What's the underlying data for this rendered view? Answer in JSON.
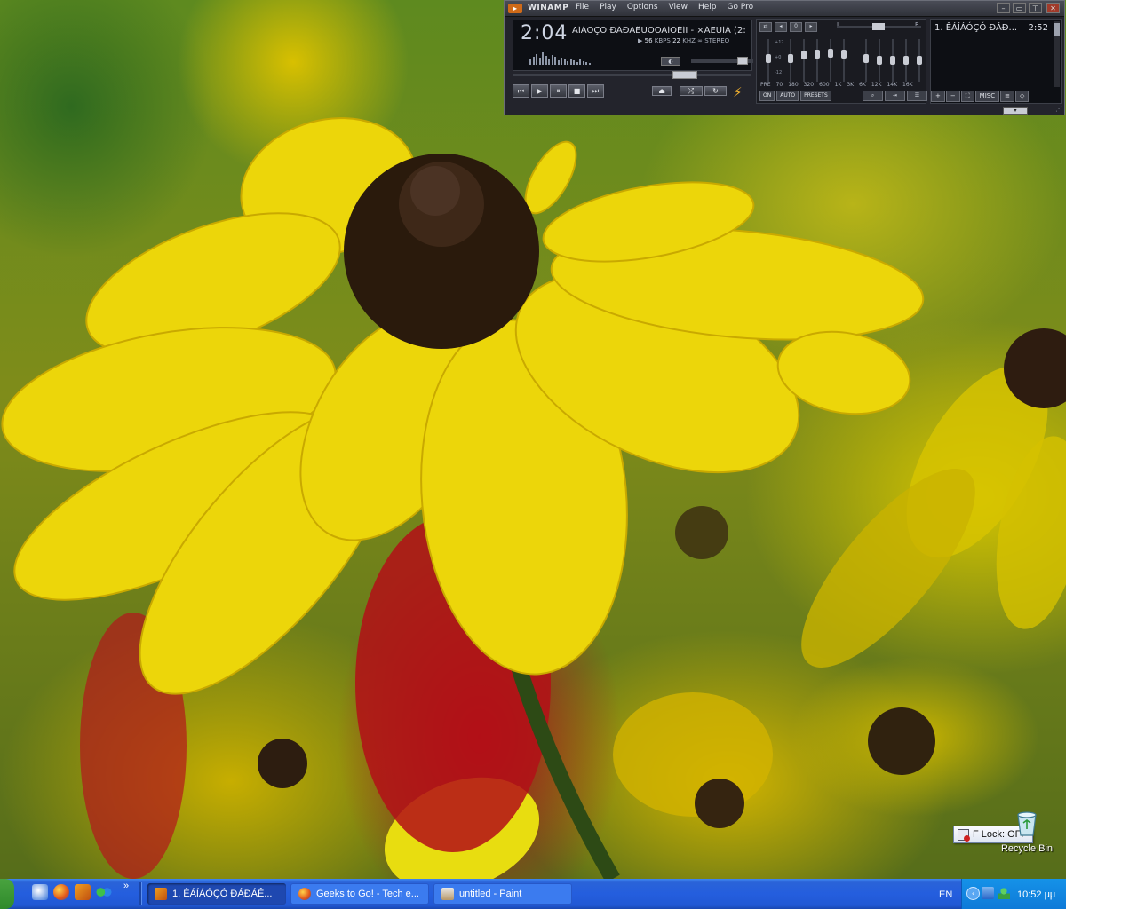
{
  "winamp": {
    "app_title": "WINAMP",
    "menu": [
      "File",
      "Play",
      "Options",
      "View",
      "Help",
      "Go Pro"
    ],
    "time": "2:04",
    "track_marquee": "ÄÍÁÓÇÓ ÐÁÐÁÊÙÓÔÁÍÔÉÍÏ - ×ÁËÙÍÁ (2:",
    "kbps_value": "56",
    "kbps_label": "KBPS",
    "khz_value": "22",
    "khz_label": "KHZ",
    "channel_mode": "STEREO",
    "playback_state": "playing",
    "seek_fraction": 0.75,
    "volume_fraction": 0.9,
    "eq": {
      "balance_left": "L",
      "balance_right": "R",
      "db_labels": [
        "+12",
        "+0",
        "-12"
      ],
      "frequencies": [
        "PRE",
        "70",
        "180",
        "320",
        "600",
        "1K",
        "3K",
        "6K",
        "12K",
        "14K",
        "16K"
      ],
      "band_levels": [
        0.45,
        0.45,
        0.35,
        0.32,
        0.3,
        0.32,
        0.45,
        0.5,
        0.5,
        0.5,
        0.5
      ],
      "buttons": [
        "ON",
        "AUTO",
        "PRESETS"
      ]
    },
    "playlist": {
      "items": [
        {
          "title": "1. ÊÁÍÁÓÇÓ ÐÁÐ...",
          "duration": "2:52"
        }
      ],
      "buttons": [
        "+",
        "−",
        "⛶",
        "MISC",
        "≡",
        "◇"
      ]
    },
    "control_icons": [
      "previous-icon",
      "play-icon",
      "pause-icon",
      "stop-icon",
      "next-icon",
      "eject-icon",
      "shuffle-icon",
      "repeat-icon",
      "lightning-icon"
    ]
  },
  "desktop": {
    "flock_label": "F Lock: OFF",
    "recycle_bin_label": "Recycle Bin"
  },
  "taskbar": {
    "quicklaunch_more": "»",
    "tasks": [
      {
        "label": "1. ÊÁÍÁÓÇÓ ÐÁÐÁÊ...",
        "icon": "winamp-icon",
        "active": true
      },
      {
        "label": "Geeks to Go! - Tech e...",
        "icon": "firefox-icon",
        "active": false
      },
      {
        "label": "untitled - Paint",
        "icon": "paint-icon",
        "active": false
      }
    ],
    "language": "EN",
    "clock": "10:52 μμ"
  },
  "colors": {
    "taskbar_blue": "#245ede",
    "tray_blue": "#0e7ad8",
    "winamp_body": "#23242c",
    "start_green": "#2f8a2b"
  }
}
